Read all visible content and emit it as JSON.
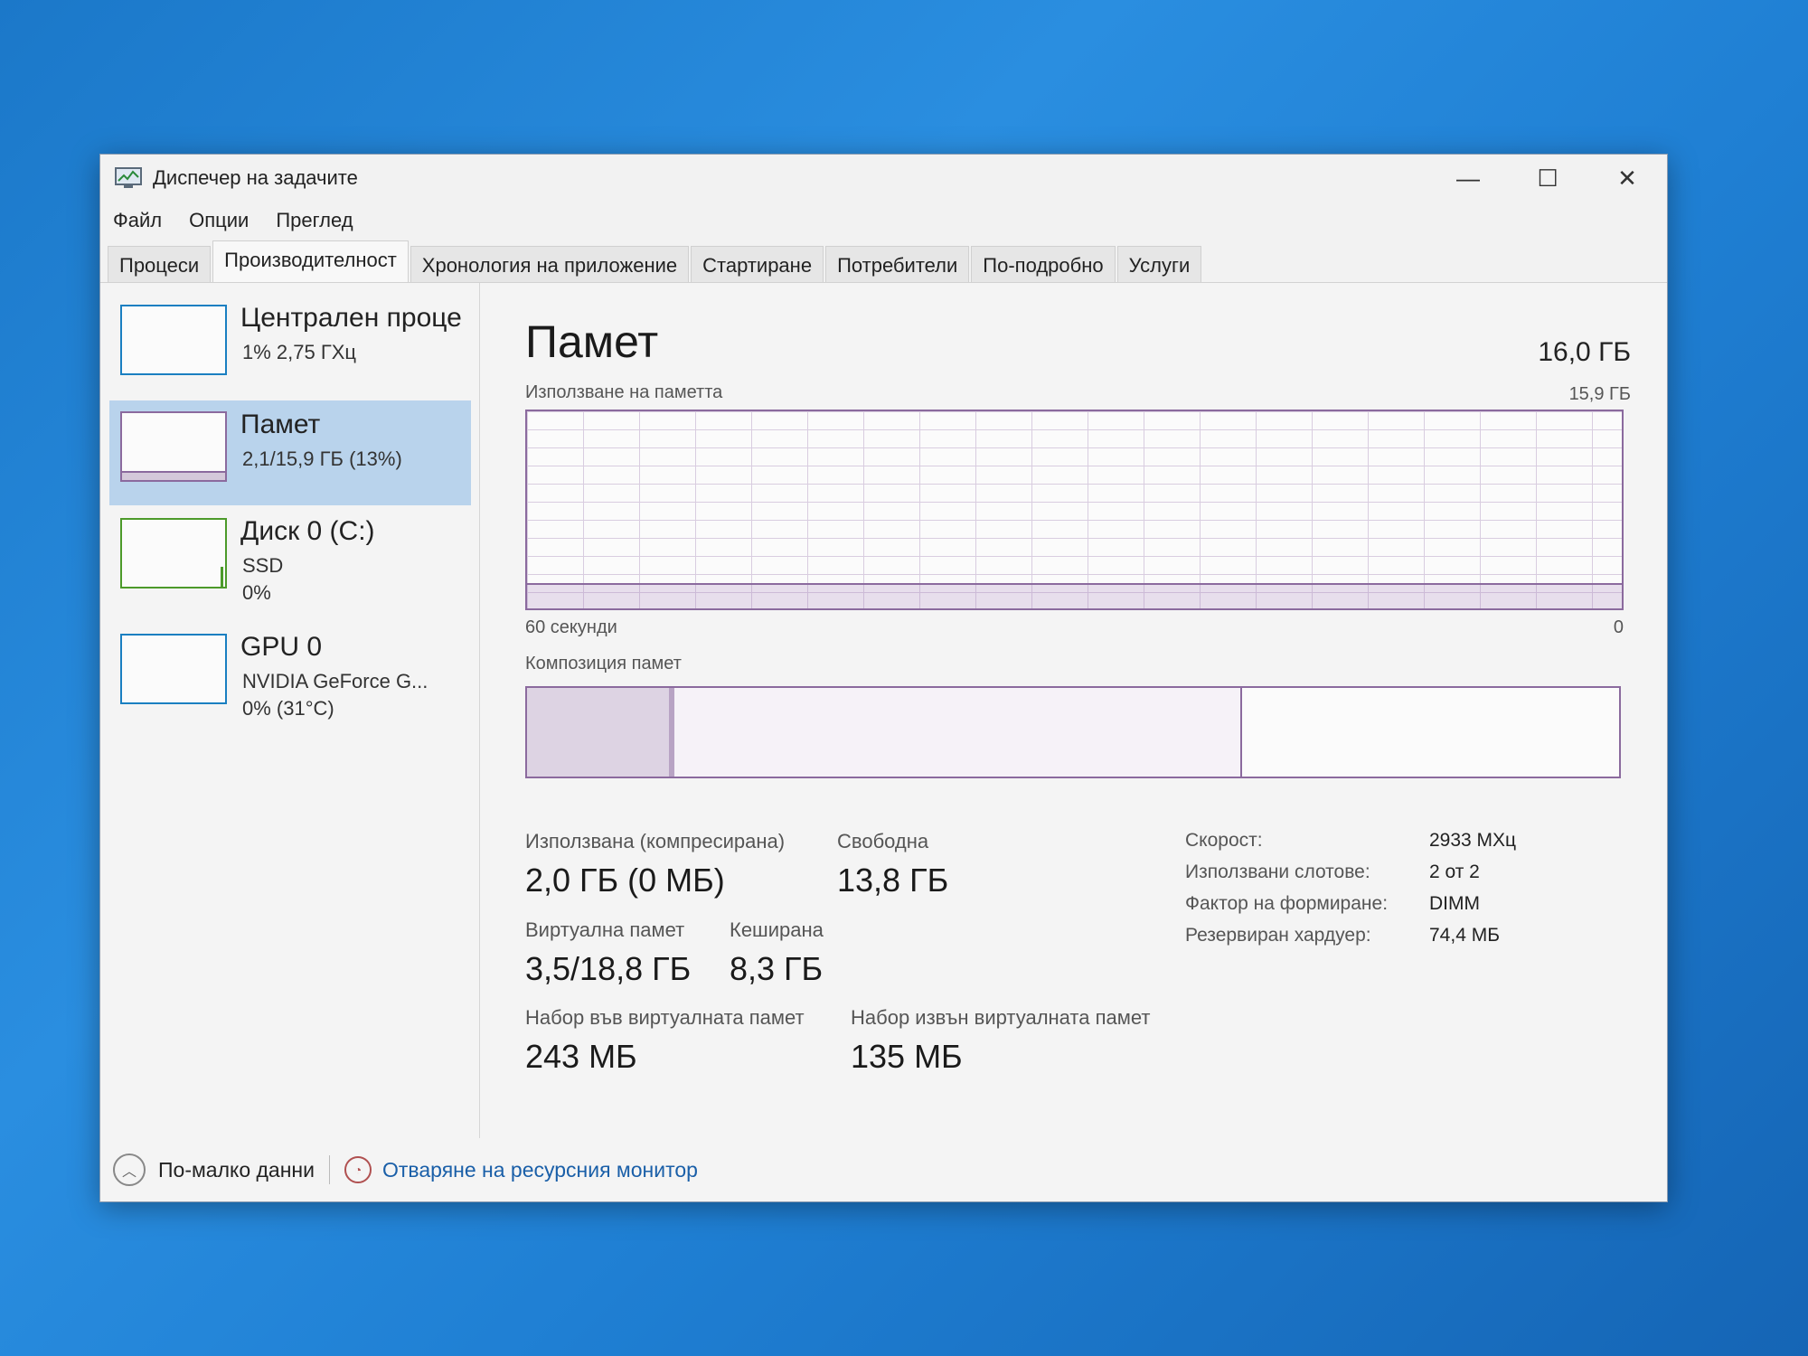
{
  "window": {
    "title": "Диспечер на задачите"
  },
  "controls": {
    "minimize": "—",
    "maximize": "☐",
    "close": "✕"
  },
  "menu": [
    "Файл",
    "Опции",
    "Преглед"
  ],
  "tabs": [
    "Процеси",
    "Производителност",
    "Хронология на приложение",
    "Стартиране",
    "Потребители",
    "По-подробно",
    "Услуги"
  ],
  "active_tab_index": 1,
  "sidebar": [
    {
      "name": "Централен проце",
      "line1": "1% 2,75 ГХц",
      "line2": ""
    },
    {
      "name": "Памет",
      "line1": "2,1/15,9 ГБ (13%)",
      "line2": ""
    },
    {
      "name": "Диск 0 (C:)",
      "line1": "SSD",
      "line2": "0%"
    },
    {
      "name": "GPU 0",
      "line1": "NVIDIA GeForce G...",
      "line2": "0% (31°C)"
    }
  ],
  "selected_sidebar_index": 1,
  "memory": {
    "title": "Памет",
    "total": "16,0 ГБ",
    "usage_label": "Използване на паметта",
    "usage_max": "15,9 ГБ",
    "usage_fraction": 0.13,
    "axis_left": "60 секунди",
    "axis_right": "0",
    "composition_label": "Композиция памет",
    "composition": {
      "in_use": 0.13,
      "modified": 0.005,
      "standby": 0.52,
      "free": 0.345
    },
    "stats": {
      "used_label": "Използвана (компресирана)",
      "used_value": "2,0 ГБ (0 МБ)",
      "free_label": "Свободна",
      "free_value": "13,8 ГБ",
      "virtual_label": "Виртуална памет",
      "virtual_value": "3,5/18,8 ГБ",
      "cached_label": "Кеширана",
      "cached_value": "8,3 ГБ",
      "paged_label": "Набор във виртуалната памет",
      "paged_value": "243 МБ",
      "nonpaged_label": "Набор извън виртуалната памет",
      "nonpaged_value": "135 МБ"
    },
    "details": [
      {
        "label": "Скорост:",
        "value": "2933 МХц"
      },
      {
        "label": "Използвани слотове:",
        "value": "2 от 2"
      },
      {
        "label": "Фактор на формиране:",
        "value": "DIMM"
      },
      {
        "label": "Резервиран хардуер:",
        "value": "74,4 МБ"
      }
    ]
  },
  "footer": {
    "fewer_details": "По-малко данни",
    "resource_monitor": "Отваряне на ресурсния монитор"
  },
  "colors": {
    "memory_accent": "#8b6a9e",
    "selected_bg": "#b9d3ec",
    "cpu_accent": "#1a7fc1",
    "disk_accent": "#4c9a2a"
  }
}
